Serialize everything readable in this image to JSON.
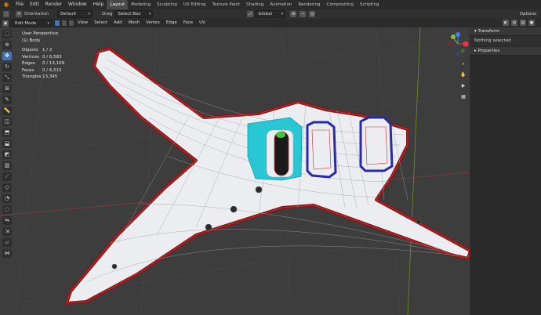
{
  "topbar": {
    "menus": [
      "File",
      "Edit",
      "Render",
      "Window",
      "Help"
    ],
    "workspaces": [
      "Layout",
      "Modeling",
      "Sculpting",
      "UV Editing",
      "Texture Paint",
      "Shading",
      "Animation",
      "Rendering",
      "Compositing",
      "Scripting"
    ],
    "active_workspace": "Layout"
  },
  "tool_header": {
    "orientation_label": "Orientation",
    "orientation_value": "Default",
    "drag_label": "Drag",
    "drag_value": "Select Box",
    "transform_orientation": "Global",
    "options_label": "Options"
  },
  "view_header": {
    "mode": "Edit Mode",
    "menus": [
      "View",
      "Select",
      "Add",
      "Mesh",
      "Vertex",
      "Edge",
      "Face",
      "UV"
    ]
  },
  "overlay_stats": {
    "view_name": "User Perspective",
    "object_name": "(1) Body",
    "rows": [
      {
        "label": "Objects",
        "value": "1 / 2"
      },
      {
        "label": "Vertices",
        "value": "0 / 6,583"
      },
      {
        "label": "Edges",
        "value": "0 / 13,109"
      },
      {
        "label": "Faces",
        "value": "0 / 6,515"
      },
      {
        "label": "Triangles",
        "value": "13,345"
      }
    ]
  },
  "sidebar": {
    "transform_header": "Transform",
    "transform_body": "Nothing selected",
    "properties_header": "Properties"
  },
  "gizmo": {
    "x_color": "#e8344c",
    "y_color": "#8bc33a",
    "z_color": "#3a84e8"
  },
  "colors": {
    "accent": "#4772b3",
    "mesh_fill": "#c9ccd3",
    "seam_red": "#c0282a",
    "cyan": "#29c6d4",
    "pickup_blue": "#2a2aa8"
  }
}
